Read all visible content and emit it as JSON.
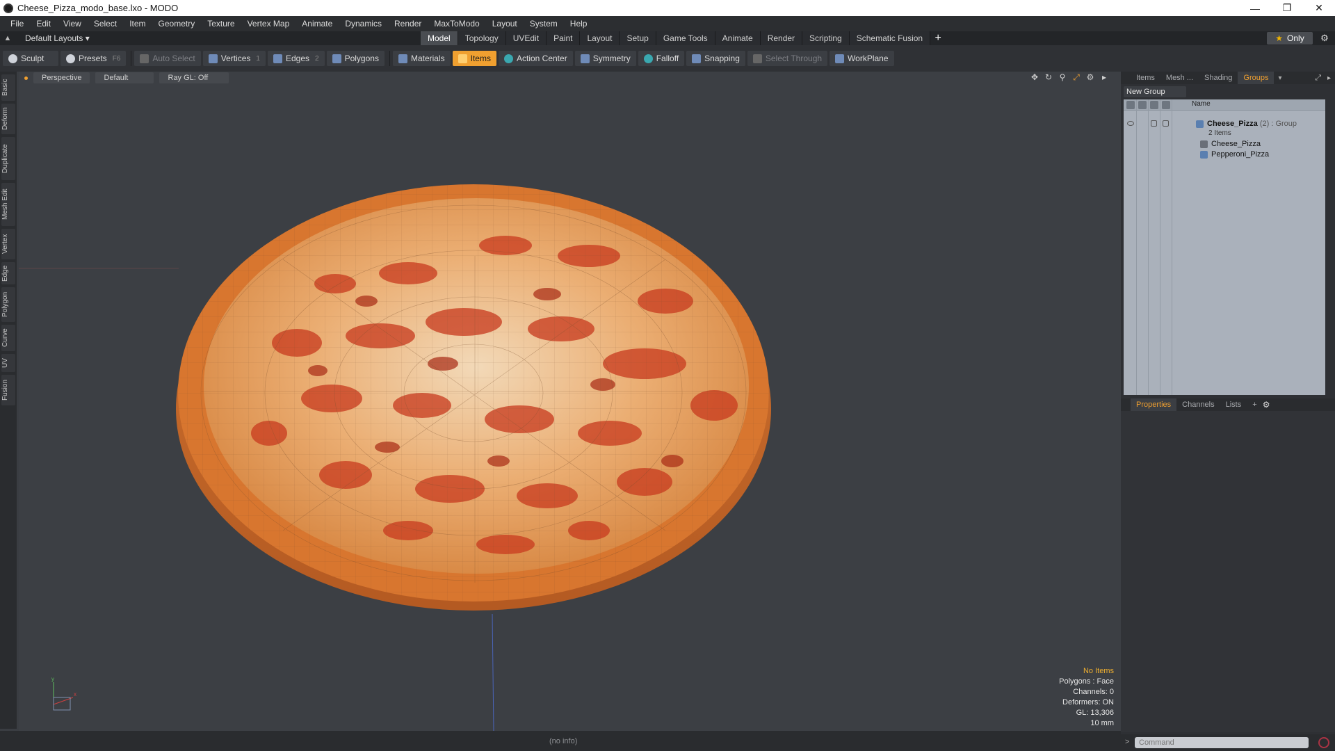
{
  "window": {
    "title": "Cheese_Pizza_modo_base.lxo - MODO"
  },
  "menu": [
    "File",
    "Edit",
    "View",
    "Select",
    "Item",
    "Geometry",
    "Texture",
    "Vertex Map",
    "Animate",
    "Dynamics",
    "Render",
    "MaxToModo",
    "Layout",
    "System",
    "Help"
  ],
  "layout_selector": "Default Layouts ▾",
  "tabs": [
    "Model",
    "Topology",
    "UVEdit",
    "Paint",
    "Layout",
    "Setup",
    "Game Tools",
    "Animate",
    "Render",
    "Scripting",
    "Schematic Fusion"
  ],
  "active_tab": "Model",
  "only_label": "Only",
  "toolbar": {
    "sculpt": "Sculpt",
    "presets": "Presets",
    "presets_key": "F6",
    "auto_select": "Auto Select",
    "vertices": "Vertices",
    "vertices_key": "1",
    "edges": "Edges",
    "edges_key": "2",
    "polygons": "Polygons",
    "materials": "Materials",
    "items": "Items",
    "action_center": "Action Center",
    "symmetry": "Symmetry",
    "falloff": "Falloff",
    "snapping": "Snapping",
    "select_through": "Select Through",
    "workplane": "WorkPlane"
  },
  "left_tabs": [
    "Basic",
    "Deform",
    "Duplicate",
    "Mesh Edit",
    "Vertex",
    "Edge",
    "Polygon",
    "Curve",
    "UV",
    "Fusion"
  ],
  "viewport": {
    "view": "Perspective",
    "shading": "Default",
    "raygl": "Ray GL: Off",
    "info": {
      "selection": "No Items",
      "polygons": "Polygons : Face",
      "channels": "Channels: 0",
      "deformers": "Deformers: ON",
      "gl": "GL: 13,306",
      "unit": "10 mm"
    },
    "colors": {
      "crust": "#c8692a",
      "cheese": "#e8a060",
      "sauce": "#c83a1e",
      "background": "#3c3f44"
    }
  },
  "status": {
    "info": "(no info)"
  },
  "right_panel": {
    "tabs": [
      "Items",
      "Mesh ...",
      "Shading",
      "Groups"
    ],
    "active_tab": "Groups",
    "new_group": "New Group",
    "column_name": "Name",
    "group": {
      "name": "Cheese_Pizza",
      "count": "(2)",
      "type": ": Group",
      "items_label": "2 Items"
    },
    "children": [
      "Cheese_Pizza",
      "Pepperoni_Pizza"
    ],
    "props_tabs": [
      "Properties",
      "Channels",
      "Lists"
    ],
    "active_props_tab": "Properties",
    "command_placeholder": "Command"
  }
}
